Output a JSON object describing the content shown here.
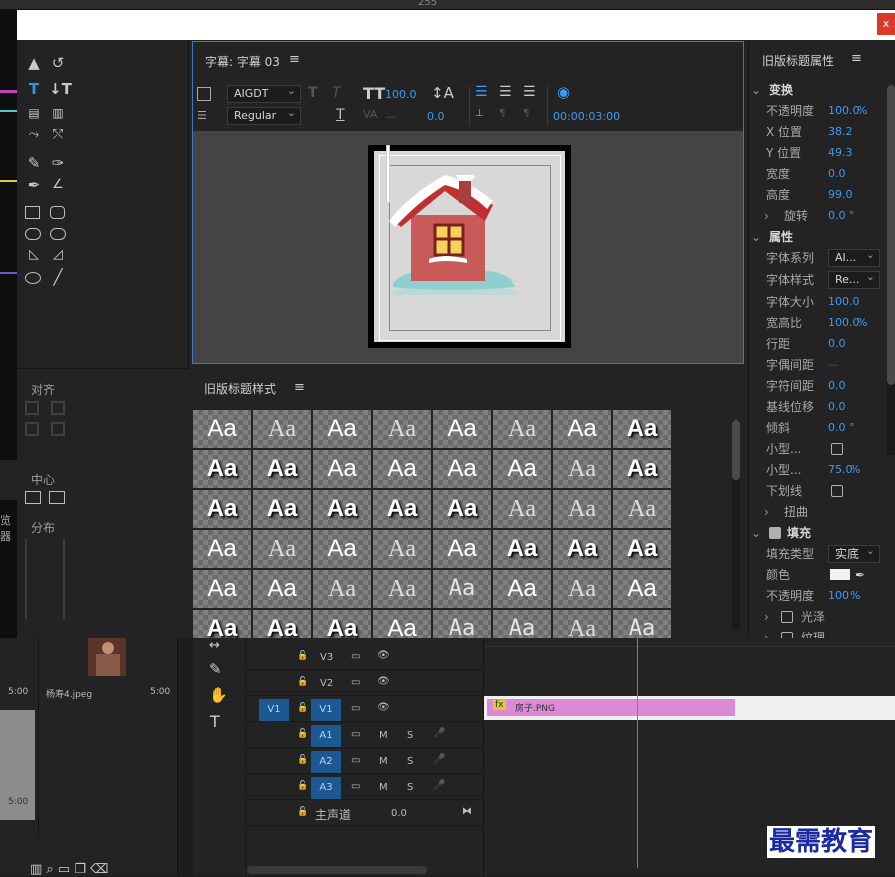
{
  "top_counter": "255",
  "dialog": {
    "close_label": "x"
  },
  "tools_panel": {
    "align_title": "对齐",
    "center_title": "中心",
    "distribute_title": "分布"
  },
  "title_panel": {
    "tab_label": "字幕: 字幕 03",
    "font_family": "AIGDT",
    "font_style": "Regular",
    "font_size": "100.0",
    "kerning": "0.0",
    "timecode": "00:00:03:00"
  },
  "styles_panel": {
    "title": "旧版标题样式",
    "rows": [
      [
        "Aa",
        "Aa",
        "Aa",
        "Aa",
        "Aa",
        "Aa",
        "Aa",
        "Aa"
      ],
      [
        "Aa",
        "Aa",
        "Aa",
        "Aa",
        "Aa",
        "Aa",
        "Aa",
        "Aa"
      ],
      [
        "Aa",
        "Aa",
        "Aa",
        "Aa",
        "Aa",
        "Aa",
        "Aa",
        "Aa"
      ],
      [
        "Aa",
        "Aa",
        "Aa",
        "Aa",
        "Aa",
        "Aa",
        "Aa",
        "Aa"
      ],
      [
        "Aa",
        "Aa",
        "Aa",
        "Aa",
        "Aa",
        "Aa",
        "Aa",
        "Aa"
      ],
      [
        "Aa",
        "Aa",
        "Aa",
        "Aa",
        "Aa",
        "Aa",
        "Aa",
        "Aa"
      ]
    ]
  },
  "properties": {
    "title": "旧版标题属性",
    "transform_section": "变换",
    "opacity_label": "不透明度",
    "opacity_value": "100.0",
    "opacity_unit": "%",
    "x_label": "X 位置",
    "x_value": "38.2",
    "y_label": "Y 位置",
    "y_value": "49.3",
    "width_label": "宽度",
    "width_value": "0.0",
    "height_label": "高度",
    "height_value": "99.0",
    "rotation_label": "旋转",
    "rotation_value": "0.0 °",
    "props_section": "属性",
    "font_family_label": "字体系列",
    "font_family_value": "AI...",
    "font_style_label": "字体样式",
    "font_style_value": "Re...",
    "font_size_label": "字体大小",
    "font_size_value": "100.0",
    "aspect_label": "宽高比",
    "aspect_value": "100.0",
    "aspect_unit": "%",
    "leading_label": "行距",
    "leading_value": "0.0",
    "kerning_label": "字偶间距",
    "kerning_value": "—",
    "tracking_label": "字符间距",
    "tracking_value": "0.0",
    "baseline_label": "基线位移",
    "baseline_value": "0.0",
    "slant_label": "倾斜",
    "slant_value": "0.0 °",
    "smallcaps_label": "小型...",
    "smallcaps_size_label": "小型...",
    "smallcaps_size_value": "75.0",
    "smallcaps_size_unit": "%",
    "underline_label": "下划线",
    "distort_label": "扭曲",
    "fill_section": "填充",
    "fill_type_label": "填充类型",
    "fill_type_value": "实底",
    "color_label": "颜色",
    "fill_opacity_label": "不透明度",
    "fill_opacity_value": "100",
    "fill_opacity_unit": "%",
    "sheen_label": "光泽",
    "texture_label": "纹理"
  },
  "project": {
    "file_name": "杨寿4.jpeg",
    "duration_1": "5:00",
    "duration_2": "5:00",
    "duration_3": "5:00",
    "side_label": "览器"
  },
  "timeline": {
    "tracks": [
      {
        "name": "V3"
      },
      {
        "name": "V2"
      },
      {
        "name": "V1",
        "source": "V1"
      },
      {
        "name": "A1",
        "m": "M",
        "s": "S"
      },
      {
        "name": "A2",
        "m": "M",
        "s": "S"
      },
      {
        "name": "A3",
        "m": "M",
        "s": "S"
      }
    ],
    "master_label": "主声道",
    "master_value": "0.0",
    "clip_label": "房子.PNG",
    "clip_fx": "fx"
  },
  "watermark": "最需教育"
}
